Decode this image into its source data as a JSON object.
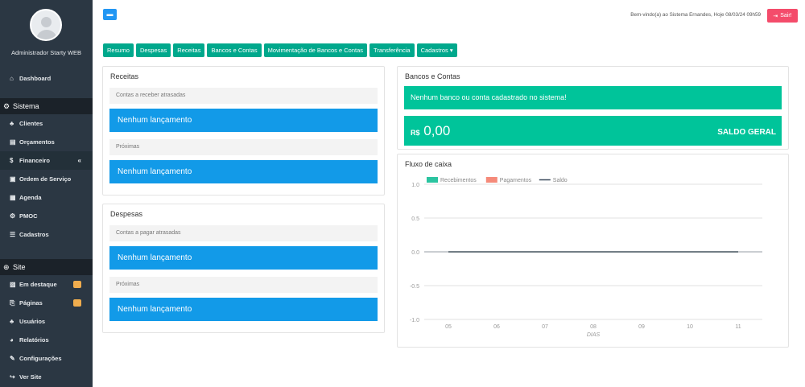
{
  "sidebar": {
    "user": "Administrador Starty WEB",
    "dashboard": {
      "icon": "home-icon",
      "label": "Dashboard"
    },
    "sistema": {
      "title": "Sistema",
      "items": [
        {
          "label": "Clientes",
          "icon": "users-icon"
        },
        {
          "label": "Orçamentos",
          "icon": "file-icon"
        },
        {
          "label": "Financeiro",
          "icon": "money-icon",
          "active": true,
          "toggle": "«"
        },
        {
          "label": "Ordem de Serviço",
          "icon": "clipboard-icon"
        },
        {
          "label": "Agenda",
          "icon": "calendar-icon"
        },
        {
          "label": "PMOC",
          "icon": "gear-icon"
        },
        {
          "label": "Cadastros",
          "icon": "list-icon"
        }
      ]
    },
    "site": {
      "title": "Site",
      "items": [
        {
          "label": "Em destaque",
          "icon": "image-icon",
          "badge": true
        },
        {
          "label": "Páginas",
          "icon": "pages-icon",
          "badge": true
        },
        {
          "label": "Usuários",
          "icon": "users-icon"
        },
        {
          "label": "Relatórios",
          "icon": "pie-icon"
        },
        {
          "label": "Configurações",
          "icon": "wrench-icon"
        },
        {
          "label": "Ver Site",
          "icon": "share-icon"
        }
      ]
    }
  },
  "topbar": {
    "welcome": "Bem-vindo(a) ao Sistema Ernandes, Hoje 08/03/24 09h59",
    "logout": "Sair!"
  },
  "tabs": [
    "Resumo",
    "Despesas",
    "Receitas",
    "Bancos e Contas",
    "Movimentação de Bancos e Contas",
    "Transferência",
    "Cadastros ▾"
  ],
  "receitas": {
    "title": "Receitas",
    "overdue": "Contas a receber atrasadas",
    "overdue_msg": "Nenhum lançamento",
    "next": "Próximas",
    "next_msg": "Nenhum lançamento"
  },
  "despesas": {
    "title": "Despesas",
    "overdue": "Contas a pagar atrasadas",
    "overdue_msg": "Nenhum lançamento",
    "next": "Próximas",
    "next_msg": "Nenhum lançamento"
  },
  "bancos": {
    "title": "Bancos e Contas",
    "empty_msg": "Nenhum banco ou conta cadastrado no sistema!",
    "currency": "R$",
    "amount": "0,00",
    "saldo_label": "SALDO GERAL"
  },
  "fluxo": {
    "title": "Fluxo de caixa"
  },
  "chart_data": {
    "type": "line",
    "xlabel": "DIAS",
    "ylabel": "",
    "x": [
      "05",
      "06",
      "07",
      "08",
      "09",
      "10",
      "11"
    ],
    "ylim": [
      -1.0,
      1.0
    ],
    "yticks": [
      "1.0",
      "0.5",
      "0.0",
      "-0.5",
      "-1.0"
    ],
    "legend_position": "top",
    "series": [
      {
        "name": "Recebimentos",
        "type": "area",
        "color": "#2bc4a0",
        "values": [
          0,
          0,
          0,
          0,
          0,
          0,
          0
        ]
      },
      {
        "name": "Pagamentos",
        "type": "area",
        "color": "#f58a7a",
        "values": [
          0,
          0,
          0,
          0,
          0,
          0,
          0
        ]
      },
      {
        "name": "Saldo",
        "type": "line",
        "color": "#3a4a5c",
        "values": [
          0,
          0,
          0,
          0,
          0,
          0,
          0
        ]
      }
    ],
    "grid": true
  }
}
